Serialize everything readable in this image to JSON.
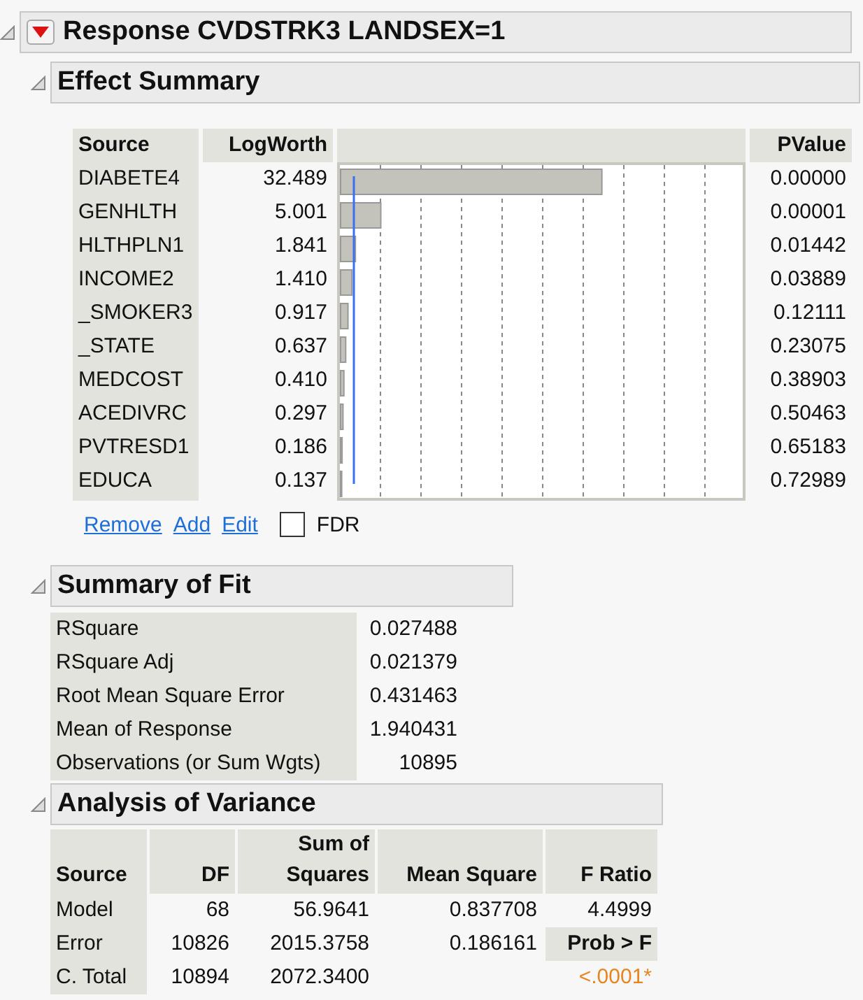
{
  "title": "Response CVDSTRK3 LANDSEX=1",
  "effect_summary": {
    "title": "Effect Summary",
    "columns": [
      "Source",
      "LogWorth",
      "PValue"
    ],
    "rows": [
      {
        "source": "DIABETE4",
        "logworth": "32.489",
        "pvalue": "0.00000"
      },
      {
        "source": "GENHLTH",
        "logworth": "5.001",
        "pvalue": "0.00001"
      },
      {
        "source": "HLTHPLN1",
        "logworth": "1.841",
        "pvalue": "0.01442"
      },
      {
        "source": "INCOME2",
        "logworth": "1.410",
        "pvalue": "0.03889"
      },
      {
        "source": "_SMOKER3",
        "logworth": "0.917",
        "pvalue": "0.12111"
      },
      {
        "source": "_STATE",
        "logworth": "0.637",
        "pvalue": "0.23075"
      },
      {
        "source": "MEDCOST",
        "logworth": "0.410",
        "pvalue": "0.38903"
      },
      {
        "source": "ACEDIVRC",
        "logworth": "0.297",
        "pvalue": "0.50463"
      },
      {
        "source": "PVTRESD1",
        "logworth": "0.186",
        "pvalue": "0.65183"
      },
      {
        "source": "EDUCA",
        "logworth": "0.137",
        "pvalue": "0.72989"
      }
    ],
    "links": [
      "Remove",
      "Add",
      "Edit"
    ],
    "fdr": {
      "label": "FDR",
      "checked": false
    }
  },
  "summary_of_fit": {
    "title": "Summary of Fit",
    "rows": [
      {
        "label": "RSquare",
        "value": "0.027488"
      },
      {
        "label": "RSquare Adj",
        "value": "0.021379"
      },
      {
        "label": "Root Mean Square Error",
        "value": "0.431463"
      },
      {
        "label": "Mean of Response",
        "value": "1.940431"
      },
      {
        "label": "Observations (or Sum Wgts)",
        "value": "10895"
      }
    ]
  },
  "analysis_of_variance": {
    "title": "Analysis of Variance",
    "columns": [
      "Source",
      "DF",
      "Sum of Squares",
      "Mean Square",
      "F Ratio"
    ],
    "rows": [
      {
        "source": "Model",
        "df": "68",
        "ss": "56.9641",
        "ms": "0.837708",
        "f": "4.4999"
      },
      {
        "source": "Error",
        "df": "10826",
        "ss": "2015.3758",
        "ms": "0.186161",
        "f": "Prob > F",
        "kind": "header"
      },
      {
        "source": "C. Total",
        "df": "10894",
        "ss": "2072.3400",
        "f": "<.0001*",
        "kind": "significant"
      }
    ]
  }
}
